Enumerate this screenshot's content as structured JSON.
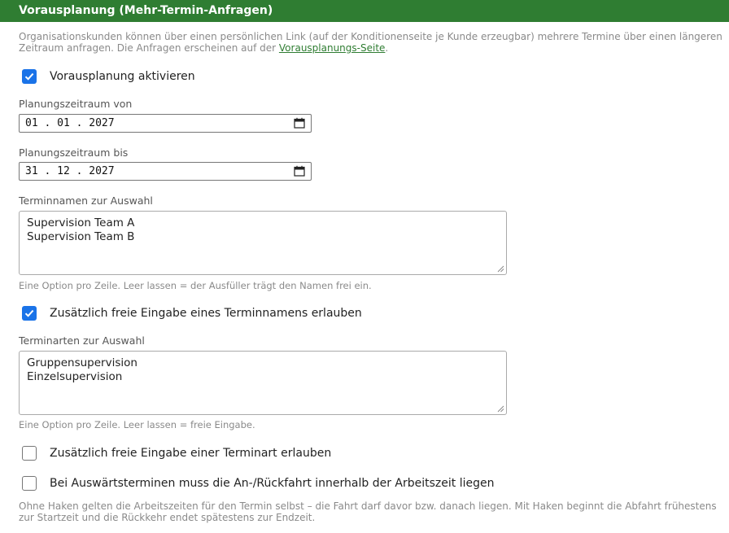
{
  "header": {
    "title": "Vorausplanung (Mehr-Termin-Anfragen)"
  },
  "intro": {
    "text": "Organisationskunden können über einen persönlichen Link (auf der Konditionenseite je Kunde erzeugbar) mehrere Termine über einen längeren Zeitraum anfragen. Die Anfragen erscheinen auf der ",
    "link": "Vorausplanungs-Seite",
    "suffix": "."
  },
  "activate": {
    "label": "Vorausplanung aktivieren",
    "checked": true
  },
  "period_from": {
    "label": "Planungszeitraum von",
    "value": "01 . 01 . 2027"
  },
  "period_to": {
    "label": "Planungszeitraum bis",
    "value": "31 . 12 . 2027"
  },
  "term_names": {
    "label": "Terminnamen zur Auswahl",
    "lines": [
      "Supervision Team A",
      "Supervision Team B"
    ],
    "hint": "Eine Option pro Zeile. Leer lassen = der Ausfüller trägt den Namen frei ein."
  },
  "allow_free_name": {
    "label": "Zusätzlich freie Eingabe eines Terminnamens erlauben",
    "checked": true
  },
  "term_types": {
    "label": "Terminarten zur Auswahl",
    "lines": [
      "Gruppensupervision",
      "Einzelsupervision"
    ],
    "hint": "Eine Option pro Zeile. Leer lassen = freie Eingabe."
  },
  "allow_free_type": {
    "label": "Zusätzlich freie Eingabe einer Terminart erlauben",
    "checked": false
  },
  "travel_in_worktime": {
    "label": "Bei Auswärtsterminen muss die An-/Rückfahrt innerhalb der Arbeitszeit liegen",
    "checked": false
  },
  "footer_note": "Ohne Haken gelten die Arbeitszeiten für den Termin selbst – die Fahrt darf davor bzw. danach liegen. Mit Haken beginnt die Abfahrt frühestens zur Startzeit und die Rückkehr endet spätestens zur Endzeit.",
  "colors": {
    "header_bg": "#2f7d32",
    "checkbox_checked": "#1a73e8"
  }
}
